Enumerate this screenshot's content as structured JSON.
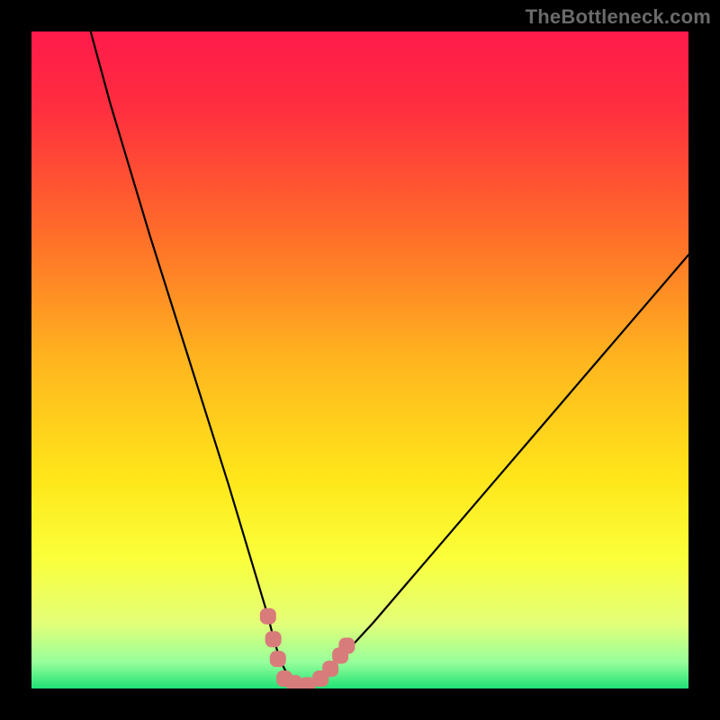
{
  "watermark": "TheBottleneck.com",
  "colors": {
    "frame": "#000000",
    "watermark": "#6a6a6a",
    "curve": "#000000",
    "marker": "#d87b7b",
    "gradient_stops": [
      {
        "offset": 0.0,
        "color": "#ff1a4b"
      },
      {
        "offset": 0.12,
        "color": "#ff2f3f"
      },
      {
        "offset": 0.3,
        "color": "#ff6a2a"
      },
      {
        "offset": 0.5,
        "color": "#ffb51f"
      },
      {
        "offset": 0.68,
        "color": "#ffe61a"
      },
      {
        "offset": 0.8,
        "color": "#faff3a"
      },
      {
        "offset": 0.9,
        "color": "#e4ff78"
      },
      {
        "offset": 0.96,
        "color": "#97ff9b"
      },
      {
        "offset": 1.0,
        "color": "#20e276"
      }
    ]
  },
  "chart_data": {
    "type": "line",
    "title": "",
    "xlabel": "",
    "ylabel": "",
    "xlim": [
      0,
      100
    ],
    "ylim": [
      0,
      100
    ],
    "legend": false,
    "grid": false,
    "series": [
      {
        "name": "bottleneck-curve",
        "x": [
          9,
          12,
          15,
          18,
          21,
          24,
          27,
          30,
          31.5,
          33,
          34.5,
          36,
          37,
          38,
          39.5,
          42,
          46,
          52,
          58,
          64,
          70,
          76,
          82,
          88,
          94,
          100
        ],
        "y": [
          100,
          89,
          79,
          69,
          59.5,
          50,
          40.5,
          31,
          26,
          21,
          16,
          11,
          7,
          4,
          1,
          0.5,
          3.5,
          10,
          17,
          24,
          31,
          38,
          45,
          52,
          59,
          66
        ]
      }
    ],
    "markers": [
      {
        "name": "valley-left-1",
        "x": 36.0,
        "y": 11.0
      },
      {
        "name": "valley-left-2",
        "x": 36.8,
        "y": 7.5
      },
      {
        "name": "valley-left-3",
        "x": 37.5,
        "y": 4.5
      },
      {
        "name": "valley-bottom-1",
        "x": 38.5,
        "y": 1.5
      },
      {
        "name": "valley-bottom-2",
        "x": 40.0,
        "y": 0.8
      },
      {
        "name": "valley-bottom-3",
        "x": 42.0,
        "y": 0.5
      },
      {
        "name": "valley-bottom-4",
        "x": 44.0,
        "y": 1.5
      },
      {
        "name": "valley-right-1",
        "x": 45.5,
        "y": 3.0
      },
      {
        "name": "valley-right-2",
        "x": 47.0,
        "y": 5.0
      },
      {
        "name": "valley-right-3",
        "x": 48.0,
        "y": 6.5
      }
    ],
    "annotations": []
  }
}
